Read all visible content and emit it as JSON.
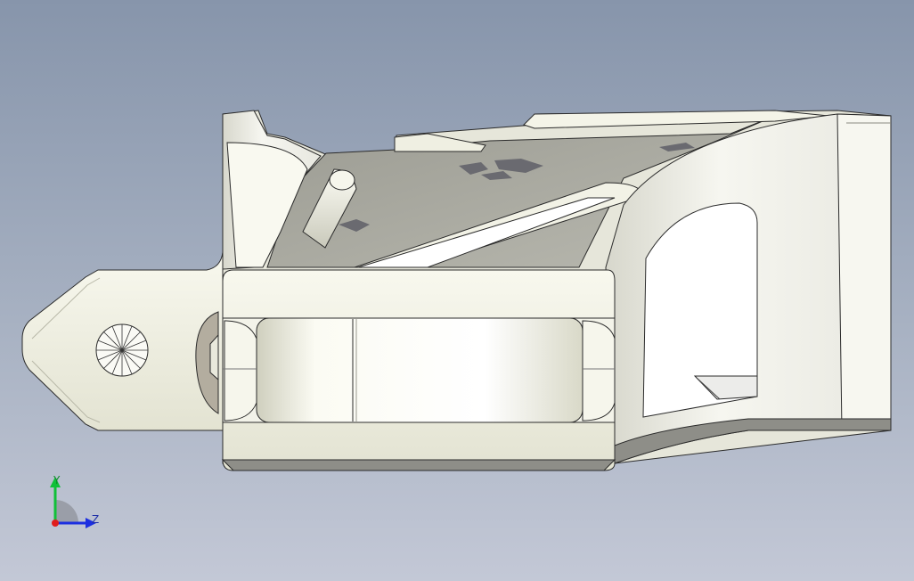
{
  "viewport": {
    "background_top": "#8795ab",
    "background_bottom": "#c3c8d6",
    "model": {
      "part_color": "#f0f0e3",
      "shadow_color": "#8c8c86",
      "edge_color": "#2b2b2b"
    }
  },
  "triad": {
    "y_label": "Y",
    "z_label": "Z",
    "y_color": "#10c038",
    "z_color": "#1c2fe0",
    "x_color": "#e01c1c"
  }
}
